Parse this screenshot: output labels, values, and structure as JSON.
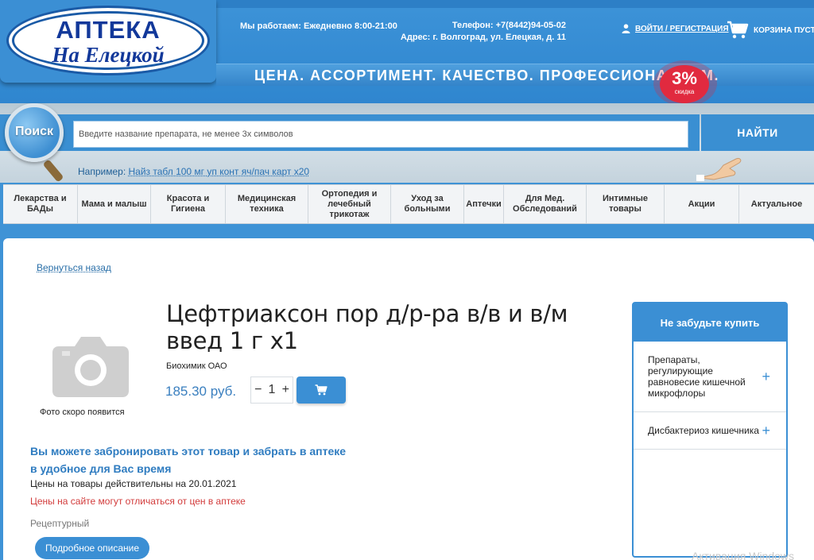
{
  "header": {
    "logo_top": "АПТЕКА",
    "logo_bottom": "На Елецкой",
    "hours": "Мы работаем: Ежедневно 8:00-21:00",
    "phone": "Телефон: +7(8442)94-05-02",
    "address": "Адрес: г. Волгоград, ул. Елецкая, д. 11",
    "login": "ВОЙТИ / РЕГИСТРАЦИЯ",
    "cart": "КОРЗИНА ПУСТА",
    "slogan": "ЦЕНА. АССОРТИМЕНТ. КАЧЕСТВО. ПРОФЕССИОНАЛИЗМ.",
    "badge_pct": "3%",
    "badge_sub": "скидка"
  },
  "search": {
    "label": "Поиск",
    "placeholder": "Введите название препарата, не менее 3х символов",
    "button": "НАЙТИ",
    "example_prefix": "Например: ",
    "example_link": "Найз табл 100 мг уп конт яч/пач карт х20"
  },
  "menu": [
    "Лекарства и БАДы",
    "Мама и малыш",
    "Красота и Гигиена",
    "Медицинская техника",
    "Ортопедия и лечебный трикотаж",
    "Уход за больными",
    "Аптечки",
    "Для Мед. Обследований",
    "Интимные товары",
    "Акции",
    "Актуальное"
  ],
  "product": {
    "back": "Вернуться назад",
    "photo_caption": "Фото скоро появится",
    "title": "Цефтриаксон пор д/р-ра в/в и в/м введ 1 г х1",
    "maker": "Биохимик ОАО",
    "price": "185.30 руб.",
    "qty": "1",
    "minus": "−",
    "plus": "+",
    "reserve": "Вы можете забронировать этот товар и забрать в аптеке в удобное для Вас время",
    "valid": "Цены на товары действительны на 20.01.2021",
    "warn": "Цены на сайте могут отличаться от цен в аптеке",
    "rx": "Рецептурный",
    "desc_btn": "Подробное описание"
  },
  "sidebar": {
    "title": "Не забудьте купить",
    "items": [
      "Препараты, регулирующие равновесие кишечной микрофлоры",
      "Дисбактериоз кишечника"
    ],
    "plus": "+"
  },
  "watermark": "Активация Windows",
  "colors": {
    "brand": "#3b8fd4",
    "accent_red": "#e12a3f",
    "warn": "#d23b3b"
  }
}
